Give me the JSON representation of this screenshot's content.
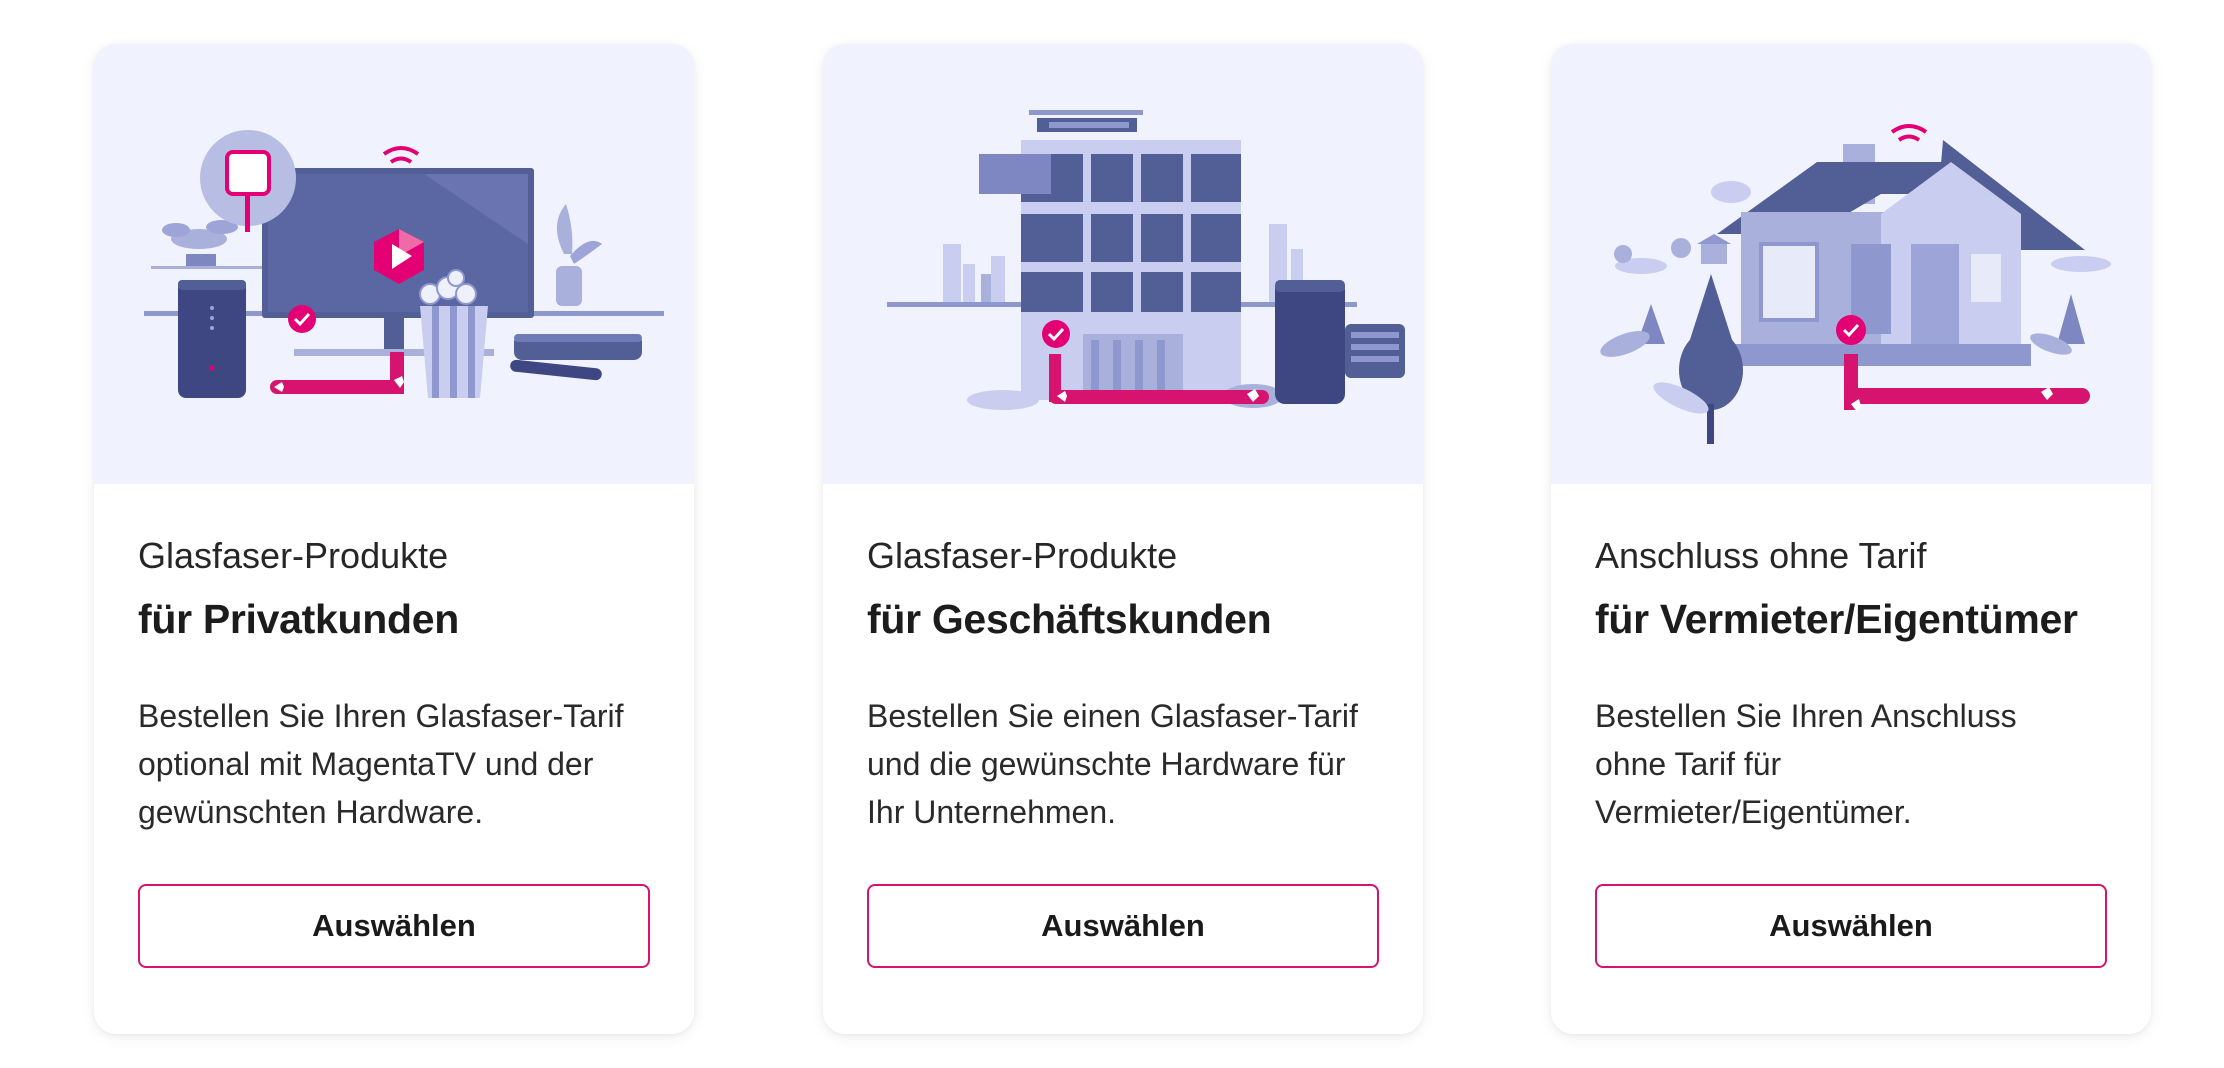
{
  "cards": [
    {
      "subtitle": "Glasfaser-Produkte",
      "title": "für Privatkunden",
      "description": "Bestellen Sie Ihren Glasfaser-Tarif optional mit MagentaTV und der gewünschten Hardware.",
      "button_label": "Auswählen",
      "illustration": "home-tv-router-illustration"
    },
    {
      "subtitle": "Glasfaser-Produkte",
      "title": "für Geschäftskunden",
      "description": "Bestellen Sie einen Glasfaser-Tarif und die gewünschte Hardware für Ihr Unternehmen.",
      "button_label": "Auswählen",
      "illustration": "office-building-router-illustration"
    },
    {
      "subtitle": "Anschluss ohne Tarif",
      "title": "für Vermieter/Eigentümer",
      "description": "Bestellen Sie Ihren Anschluss ohne Tarif für Vermieter/Eigentümer.",
      "button_label": "Auswählen",
      "illustration": "house-fiber-connection-illustration"
    }
  ],
  "colors": {
    "accent": "#e20074",
    "button_border": "#d6136f",
    "illustration_background": "#f0f3fd",
    "illustration_primary": "#525e96",
    "illustration_light": "#b8bde3"
  }
}
